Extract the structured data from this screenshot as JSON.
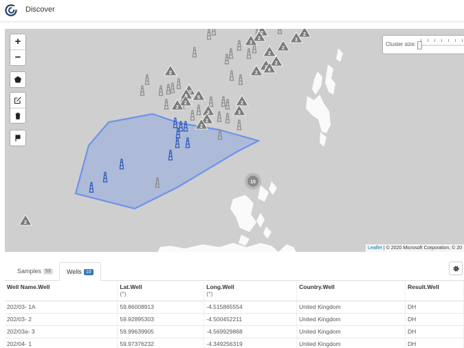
{
  "header": {
    "title": "Discover"
  },
  "map": {
    "zoom_in": "+",
    "zoom_out": "−",
    "cluster_label": "Cluster size:",
    "attribution_link": "Leaflet",
    "attribution_text": " | © 2020 Microsoft Corporation, © 20",
    "clusters": [
      {
        "n": "2"
      },
      {
        "n": "2"
      },
      {
        "n": "3"
      },
      {
        "n": "2"
      },
      {
        "n": "3"
      },
      {
        "n": "2"
      },
      {
        "n": "2"
      },
      {
        "n": "2"
      },
      {
        "n": "2"
      },
      {
        "n": "6"
      },
      {
        "n": "2"
      },
      {
        "n": "2"
      },
      {
        "n": "10"
      },
      {
        "n": "5"
      },
      {
        "n": "5"
      },
      {
        "n": "2"
      },
      {
        "n": "3"
      },
      {
        "n": "2"
      },
      {
        "n": "2"
      },
      {
        "n": "3"
      },
      {
        "n": "2"
      },
      {
        "n": "2"
      },
      {
        "n": "2"
      }
    ],
    "circle_cluster": "15"
  },
  "tabs": [
    {
      "label": "Samples",
      "count": "53"
    },
    {
      "label": "Wells",
      "count": "10"
    }
  ],
  "table": {
    "columns": [
      {
        "name": "Well Name.Well",
        "unit": ""
      },
      {
        "name": "Lat.Well",
        "unit": "(°)"
      },
      {
        "name": "Long.Well",
        "unit": "(°)"
      },
      {
        "name": "Country.Well",
        "unit": ""
      },
      {
        "name": "Result.Well",
        "unit": ""
      }
    ],
    "rows": [
      [
        "202/03- 1A",
        "59.86008913",
        "-4.515865554",
        "United Kingdom",
        "DH"
      ],
      [
        "202/03- 2",
        "59.92895303",
        "-4.500452211",
        "United Kingdom",
        "DH"
      ],
      [
        "202/03a- 3",
        "59.99639905",
        "-4.569929868",
        "United Kingdom",
        "DH"
      ],
      [
        "202/04- 1",
        "59.97376232",
        "-4.349256319",
        "United Kingdom",
        "DH"
      ]
    ]
  },
  "colors": {
    "selection": "#6d93e8",
    "selected_well": "#2a55b8",
    "well": "#8a8a8a",
    "badge_active": "#337ab7"
  }
}
